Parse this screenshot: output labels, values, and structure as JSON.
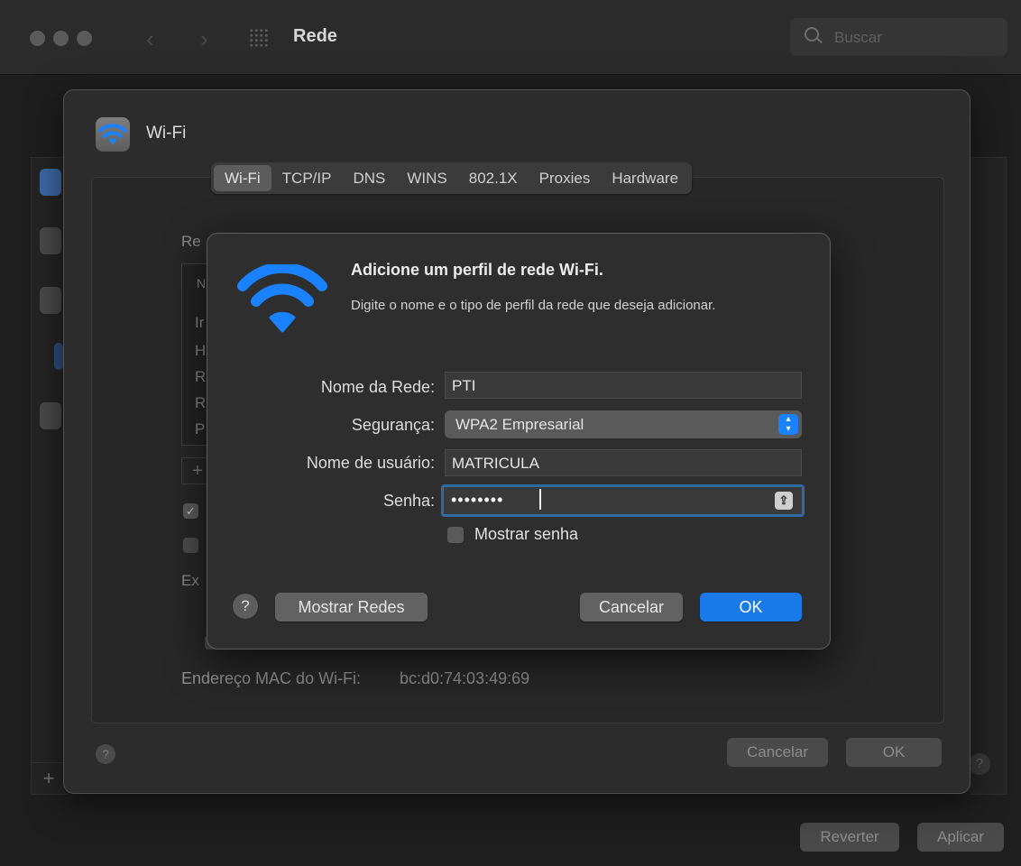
{
  "window": {
    "title": "Rede",
    "search_placeholder": "Buscar"
  },
  "background_buttons": {
    "cancel": "Cancelar",
    "ok": "OK",
    "revert": "Reverter",
    "apply": "Aplicar"
  },
  "sheet": {
    "title": "Wi-Fi",
    "tabs": [
      "Wi-Fi",
      "TCP/IP",
      "DNS",
      "WINS",
      "802.1X",
      "Proxies",
      "Hardware"
    ],
    "active_tab": "Wi-Fi",
    "peek": {
      "networks_label": "Re",
      "list_header": "N",
      "list_rows": [
        "Ir",
        "H",
        "R",
        "R",
        "P"
      ],
      "export_label": "Ex"
    },
    "mac_label": "Endereço MAC do Wi-Fi:",
    "mac_value": "bc:d0:74:03:49:69"
  },
  "dialog": {
    "title": "Adicione um perfil de rede Wi-Fi.",
    "subtitle": "Digite o nome e o tipo de perfil da rede que deseja adicionar.",
    "network_name_label": "Nome da Rede:",
    "network_name_value": "PTI",
    "security_label": "Segurança:",
    "security_value": "WPA2 Empresarial",
    "username_label": "Nome de usuário:",
    "username_value": "MATRICULA",
    "password_label": "Senha:",
    "password_masked": "••••••••",
    "show_password_label": "Mostrar senha",
    "show_password_checked": false,
    "help": "?",
    "show_networks_button": "Mostrar Redes",
    "cancel_button": "Cancelar",
    "ok_button": "OK"
  },
  "colors": {
    "accent": "#1a7ae8",
    "wifi_blue": "#1a82ff"
  }
}
